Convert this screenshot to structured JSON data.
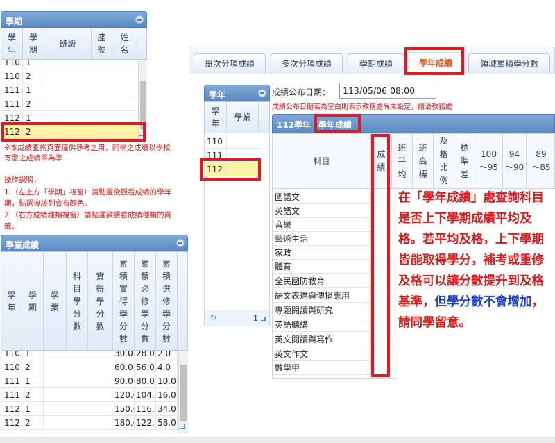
{
  "semester_panel": {
    "title": "學期",
    "columns": [
      {
        "label": "學\n年"
      },
      {
        "label": "學\n期"
      },
      {
        "label": "班級"
      },
      {
        "label": "座\n號"
      },
      {
        "label": "姓\n名"
      }
    ],
    "rows": [
      [
        "110",
        "1"
      ],
      [
        "110",
        "2"
      ],
      [
        "111",
        "1"
      ],
      [
        "111",
        "2"
      ],
      [
        "112",
        "1"
      ],
      [
        "112",
        "2"
      ]
    ]
  },
  "notes_left": {
    "line1": "※本成績查詢頁面僅供參考之用，同學之成績以學校",
    "line2": "寄發之成績單為準",
    "instructions_title": "操作說明：",
    "step1a": "1.（左上方「學期」視窗）請點選欲觀看成績的學年",
    "step1b": "期，點選後該列會有顏色。",
    "step2a": "2.（右方成績種類視窗）請點選欲觀看成績種類的頁",
    "step2b": "籤。"
  },
  "academic_panel": {
    "title": "學業成績",
    "columns": [
      {
        "label": "學\n年"
      },
      {
        "label": "學\n期"
      },
      {
        "label": "學\n業"
      },
      {
        "label": "科\n目\n學\n分\n數"
      },
      {
        "label": "實\n得\n學\n分\n數"
      },
      {
        "label": "累\n積\n實\n得\n學\n分\n數"
      },
      {
        "label": "累\n積\n必\n修\n學\n分\n數"
      },
      {
        "label": "累\n積\n選\n修\n學\n分\n數"
      }
    ],
    "rows": [
      [
        "110",
        "1",
        "",
        "",
        "",
        "30.0",
        "28.0",
        "2.0"
      ],
      [
        "110",
        "2",
        "",
        "",
        "",
        "60.0",
        "56.0",
        "4.0"
      ],
      [
        "111",
        "1",
        "",
        "",
        "",
        "90.0",
        "80.0",
        "10.0"
      ],
      [
        "111",
        "2",
        "",
        "",
        "",
        "120.0",
        "104.0",
        "16.0"
      ],
      [
        "112",
        "1",
        "",
        "",
        "",
        "150.0",
        "116.0",
        "34.0"
      ],
      [
        "112",
        "2",
        "",
        "",
        "",
        "180.0",
        "122.0",
        "58.0"
      ]
    ]
  },
  "tabs": [
    {
      "label": "單次分項成績"
    },
    {
      "label": "多次分項成績"
    },
    {
      "label": "學期成績"
    },
    {
      "label": "學年成績"
    },
    {
      "label": "領域累積學分數"
    }
  ],
  "year_panel": {
    "title": "學年",
    "columns": [
      {
        "label": "學\n年"
      },
      {
        "label": "學業"
      }
    ],
    "rows": [
      "110",
      "111",
      "112"
    ],
    "pager_count": "1"
  },
  "publish": {
    "label": "成績公布日期：",
    "value": "113/05/06 08:00",
    "hint": "成績公布日期若為空白則表示教務處尚未設定，請洽教務處"
  },
  "year_score": {
    "year_label": "112學年",
    "title": "學年成績",
    "columns": [
      {
        "label": "科目"
      },
      {
        "label": "成\n績"
      },
      {
        "label": "班\n平\n均"
      },
      {
        "label": "班\n高\n標"
      },
      {
        "label": "及\n格\n比\n例"
      },
      {
        "label": "標\n準\n差"
      },
      {
        "label": "100\n～95"
      },
      {
        "label": "94\n～90"
      },
      {
        "label": "89\n～85"
      }
    ],
    "subjects": [
      "國語文",
      "英語文",
      "音樂",
      "藝術生活",
      "家政",
      "體育",
      "全民國防教育",
      "語文表達與傳播應用",
      "專題閱讀與研究",
      "英語聽講",
      "英文閱讀與寫作",
      "英文作文",
      "數學甲"
    ]
  },
  "annotation": {
    "part1": "在「學年成績」處查詢科目是否上下學期成績平均及格。若平均及格，上下學期皆能取得學分，補考或重修及格可以讓分數提升到及格基準，",
    "part2": "但學分數不會增加",
    "part3": "，請同學留意。"
  }
}
